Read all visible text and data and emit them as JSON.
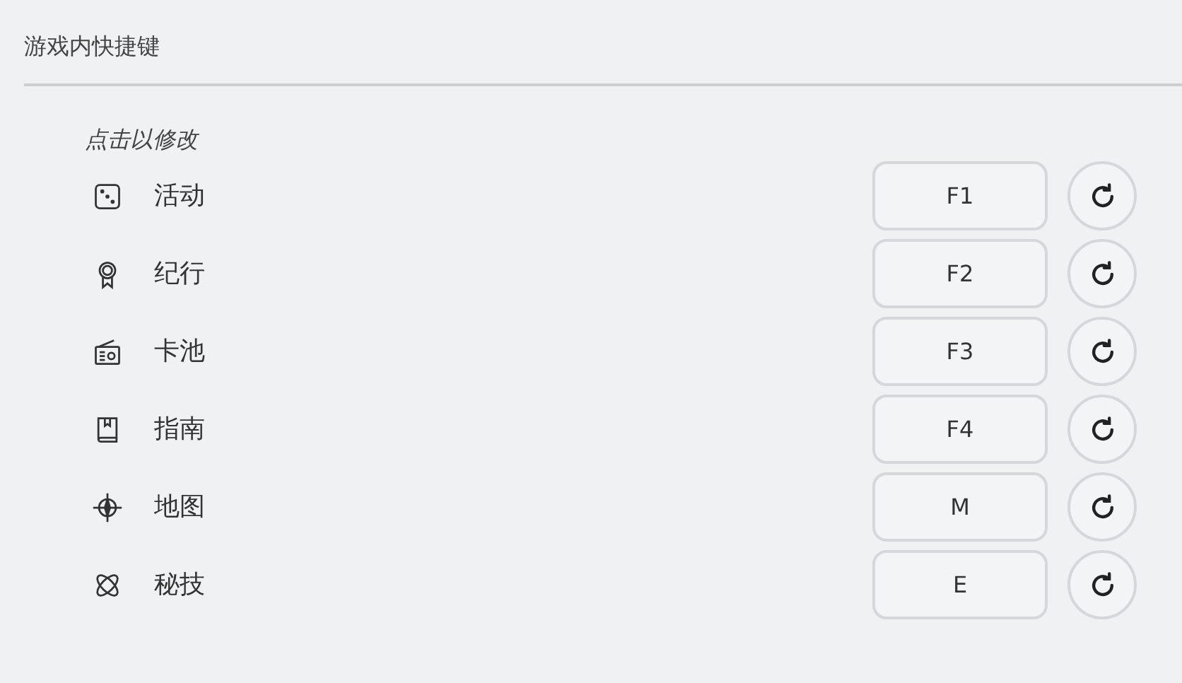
{
  "title": "游戏内快捷键",
  "hint": "点击以修改",
  "shortcuts": [
    {
      "label": "活动",
      "key": "F1"
    },
    {
      "label": "纪行",
      "key": "F2"
    },
    {
      "label": "卡池",
      "key": "F3"
    },
    {
      "label": "指南",
      "key": "F4"
    },
    {
      "label": "地图",
      "key": "M"
    },
    {
      "label": "秘技",
      "key": "E"
    }
  ]
}
